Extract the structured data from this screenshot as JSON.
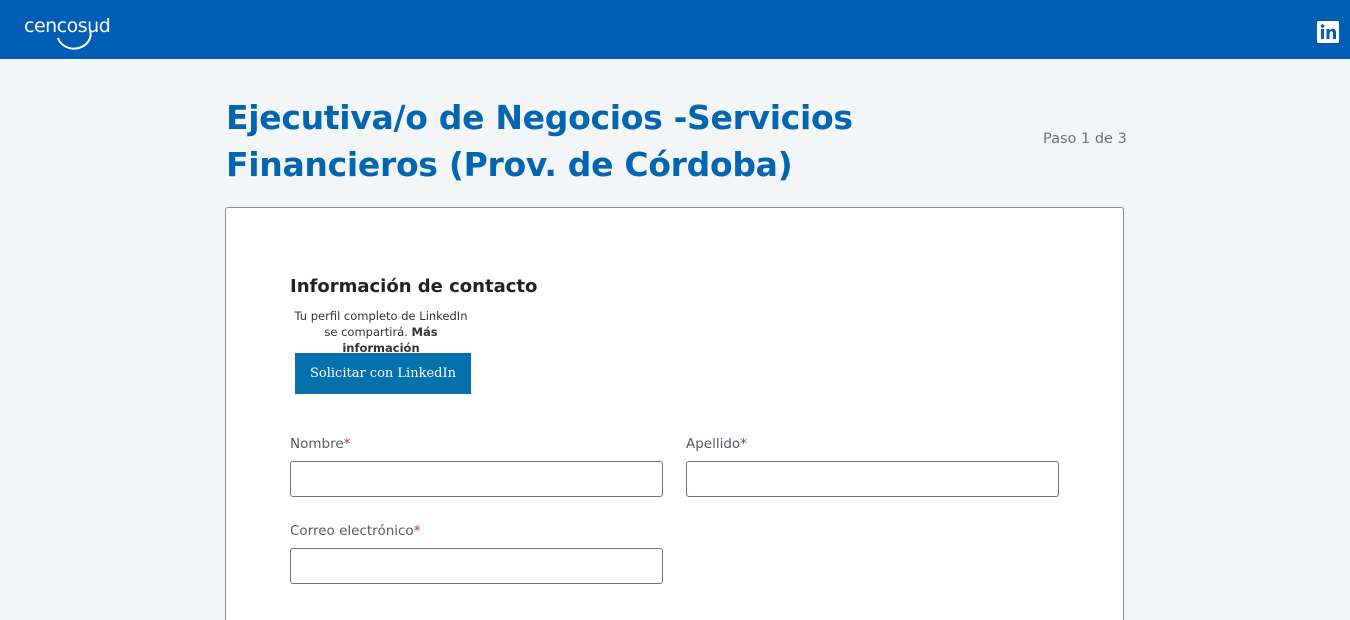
{
  "header": {
    "logo_text": "cencosud",
    "social_icon": "linkedin-icon",
    "background_color": "#015db6"
  },
  "job": {
    "title": "Ejecutiva/o de Negocios -Servicios Financieros (Prov. de Córdoba)",
    "step": "Paso 1 de 3",
    "title_color": "#0265b0"
  },
  "form": {
    "section_title": "Información de contacto",
    "linkedin_note_line1": "Tu perfil completo de LinkedIn",
    "linkedin_note_line2": "se compartirá.",
    "linkedin_note_link": "Más información",
    "linkedin_button_label": "Solicitar con LinkedIn",
    "linkedin_button_color": "#0572ae",
    "fields": {
      "first_name": {
        "label": "Nombre",
        "required_mark": "*",
        "value": ""
      },
      "last_name": {
        "label": "Apellido",
        "required_mark": "*",
        "value": ""
      },
      "email": {
        "label": "Correo electrónico",
        "required_mark": "*",
        "value": ""
      }
    }
  }
}
